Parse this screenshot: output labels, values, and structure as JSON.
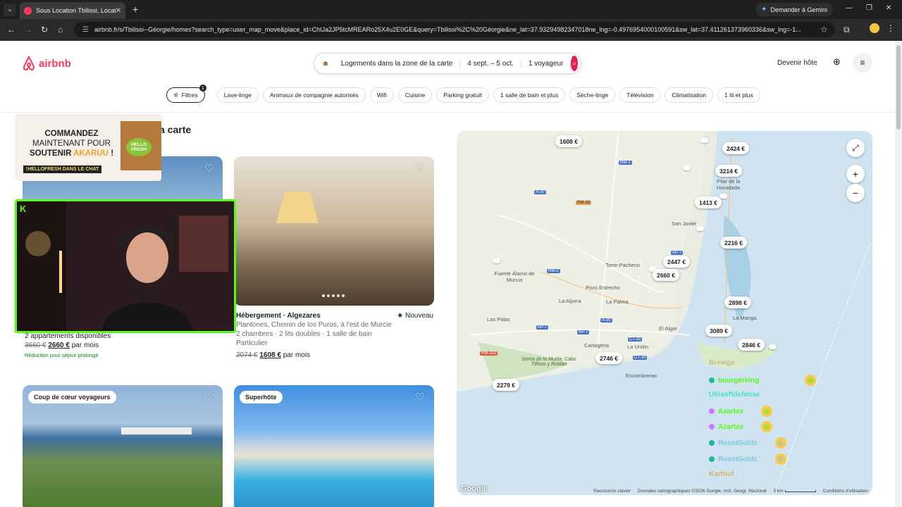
{
  "browser": {
    "tab_title": "Sous Location Tbilissi, Location",
    "gemini_label": "Demander à Gemini",
    "url": "airbnb.fr/s/Tbilissi--Géorgie/homes?search_type=user_map_move&place_id=ChIJa2JP5tcMREARo25X4u2E0GE&query=Tbilissi%2C%20Géorgie&ne_lat=37.93294982347018ne_lng=-0.4976954000100591&sw_lat=37.411261373960336&sw_lng=-1..."
  },
  "header": {
    "logo_text": "airbnb",
    "search_zone": "Logements dans la zone de la carte",
    "search_dates": "4 sept. – 5 oct.",
    "search_guests": "1 voyageur",
    "host_label": "Devenir hôte"
  },
  "filters": {
    "filters_label": "Filtres",
    "filters_count": "1",
    "chips": [
      "Lave-linge",
      "Animaux de compagnie autorisés",
      "Wifi",
      "Cuisine",
      "Parking gratuit",
      "1 salle de bain et plus",
      "Sèche-linge",
      "Télévision",
      "Climatisation",
      "1 lit et plus"
    ]
  },
  "results_title": "a carte",
  "listings": [
    {
      "units": "2 appartements disponibles",
      "old_price": "3660 €",
      "new_price": "2660 €",
      "per": "par mois",
      "promo": "Réduction pour séjour prolongé"
    },
    {
      "title": "Hébergement · Algezares",
      "badge": "Nouveau",
      "line1": "Plantones, Chemin de los Puros, à l'est de Murcie",
      "line2": "2 chambres · 2 lits doubles · 1 salle de bain",
      "line3": "Particulier",
      "old_price": "2074 €",
      "new_price": "1608 €",
      "per": "par mois"
    },
    {
      "badge": "Coup de cœur voyageurs"
    },
    {
      "badge": "Superhôte"
    }
  ],
  "map": {
    "pins": [
      "1608 €",
      "2424 €",
      "3214 €",
      "1413 €",
      "2216 €",
      "2447 €",
      "2660 €",
      "2898 €",
      "3089 €",
      "2846 €",
      "2746 €",
      "2279 €"
    ],
    "places": [
      "Torre-Pacheco",
      "Fuente Álamo de Murcia",
      "Pozo Estrecho",
      "La Aljorra",
      "La Palma",
      "Las Palas",
      "El Algar",
      "Cartagena",
      "La Unión",
      "Escombreras",
      "San Javier",
      "Pilar de la Horadada",
      "La Manga",
      "Sierra de la Muela, Cabo Tiñoso y Roldán"
    ],
    "roads": [
      "RM-1",
      "A-30",
      "RM-19",
      "AP-7",
      "RM-2",
      "A-30",
      "AP-7",
      "AP-7",
      "CT-32",
      "CT-34",
      "RM-332"
    ],
    "attribution": [
      "Raccourcis clavier",
      "Données cartographiques ©2026 Google, Inst. Geogr. Nacional",
      "5 km",
      "Conditions d'utilisation"
    ],
    "google_label": "Google"
  },
  "overlay": {
    "ad_line1": "COMMANDEZ",
    "ad_line2": "MAINTENANT POUR",
    "ad_line3a": "SOUTENIR ",
    "ad_line3b": "AKARUU",
    "ad_line3c": " !",
    "ad_tag": "!HELLOFRESH DANS LE CHAT",
    "ad_brand": "HELLO FRESH",
    "chat": [
      "Brewgo",
      "bourgerking",
      "Ubisoftdefense",
      "Azartax",
      "Azartax",
      "RoastGoldz",
      "RoastGoldz",
      "Kartouf"
    ]
  }
}
